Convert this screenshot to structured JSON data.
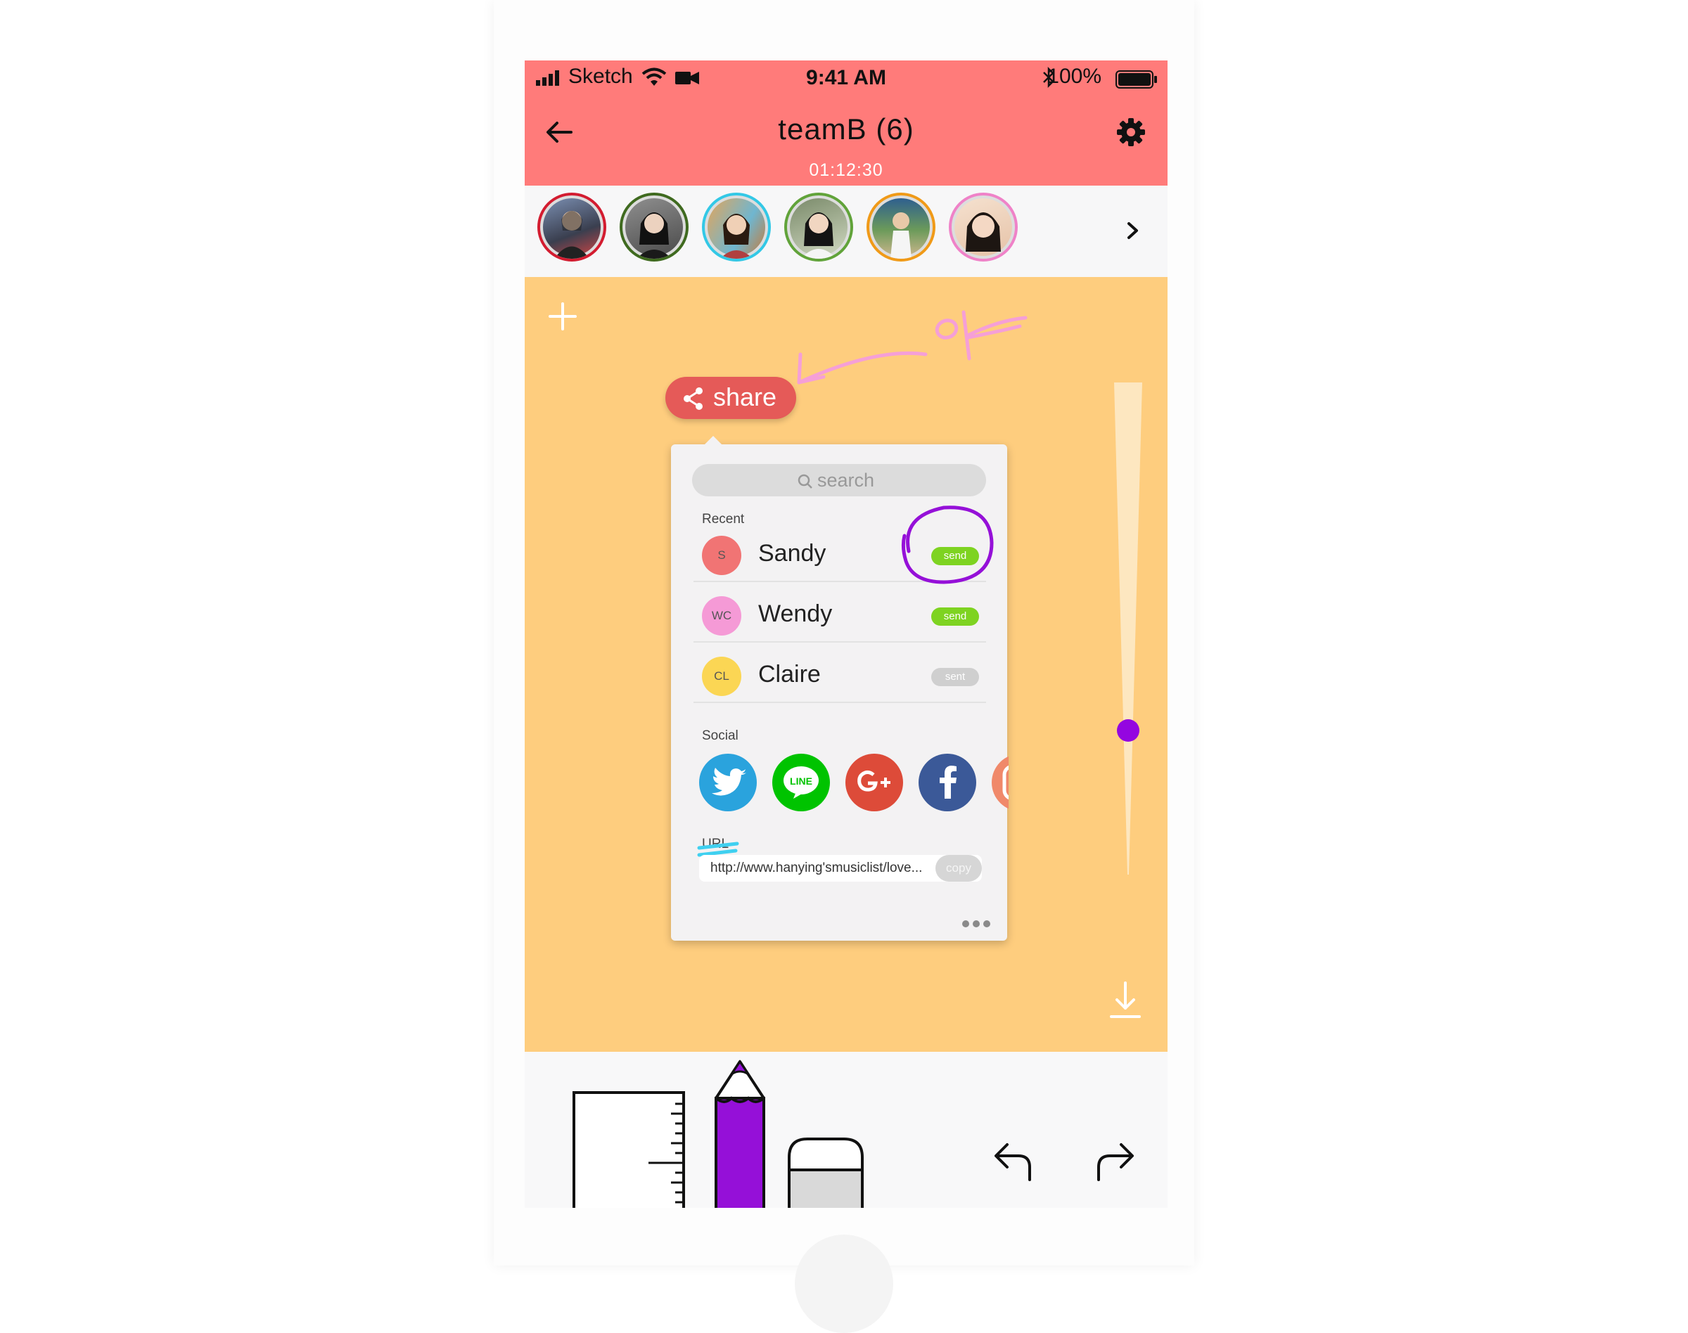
{
  "status_bar": {
    "carrier": "Sketch",
    "time": "9:41 AM",
    "battery": "100%"
  },
  "header": {
    "title": "teamB (6)",
    "timer": "01:12:30"
  },
  "members": [
    {
      "ring": "#d31c30",
      "bg": "#5b6b88"
    },
    {
      "ring": "#3f6a1f",
      "bg": "#3a3a3a"
    },
    {
      "ring": "#33c8e6",
      "bg": "#d48a4a"
    },
    {
      "ring": "#61a33a",
      "bg": "#6a7a5a"
    },
    {
      "ring": "#f09a18",
      "bg": "#3f6f9a"
    },
    {
      "ring": "#ef82c8",
      "bg": "#e8cbb0"
    }
  ],
  "canvas": {
    "annotation": "ok",
    "slider_level": 0.75
  },
  "share": {
    "button_label": "share",
    "search_placeholder": "search",
    "recent_label": "Recent",
    "recent": [
      {
        "initials": "S",
        "name": "Sandy",
        "status": "send",
        "avatar_color": "#f17474",
        "pill_color": "#7ed321"
      },
      {
        "initials": "WC",
        "name": "Wendy",
        "status": "send",
        "avatar_color": "#f59ad6",
        "pill_color": "#7ed321"
      },
      {
        "initials": "CL",
        "name": "Claire",
        "status": "sent",
        "avatar_color": "#fbd654",
        "pill_color": "#cfcfcf"
      }
    ],
    "social_label": "Social",
    "social": [
      {
        "icon": "twitter-icon",
        "color": "#2aa3dd"
      },
      {
        "icon": "line-icon",
        "color": "#00c300",
        "text": "LINE"
      },
      {
        "icon": "google-plus-icon",
        "color": "#dd4b39"
      },
      {
        "icon": "facebook-icon",
        "color": "#3b5998"
      },
      {
        "icon": "instagram-icon",
        "color": "#f0896a"
      }
    ],
    "url_label": "URL",
    "url": "http://www.hanying'smusiclist/love...",
    "copy_label": "copy"
  },
  "toolbar": {
    "pencil_color": "#9510d8"
  }
}
